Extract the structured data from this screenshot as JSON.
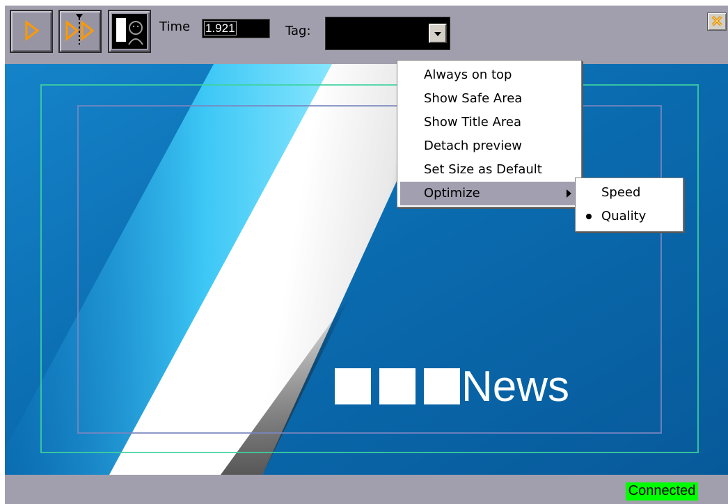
{
  "toolbar": {
    "time_label": "Time",
    "time_value": "1.921",
    "tag_label": "Tag:",
    "tag_value": ""
  },
  "preview": {
    "logo_text": "News"
  },
  "context_menu": {
    "items": [
      {
        "label": "Always on top"
      },
      {
        "label": "Show Safe Area"
      },
      {
        "label": "Show Title Area"
      },
      {
        "label": "Detach preview"
      },
      {
        "label": "Set Size as Default"
      },
      {
        "label": "Optimize",
        "has_submenu": true,
        "active": true
      }
    ],
    "submenu": {
      "items": [
        {
          "label": "Speed",
          "selected": false
        },
        {
          "label": "Quality",
          "selected": true
        }
      ]
    }
  },
  "status": {
    "text": "Connected",
    "color": "#00ff00"
  },
  "colors": {
    "frame_bg": "#a19fad",
    "preview_blue": "#0a6aae",
    "menu_highlight": "#a29fb0",
    "play_accent": "#ff9900"
  },
  "icons": [
    "play-icon",
    "step-forward-icon",
    "preview-mode-icon",
    "dropdown-arrow-icon",
    "close-icon",
    "submenu-arrow-icon"
  ]
}
